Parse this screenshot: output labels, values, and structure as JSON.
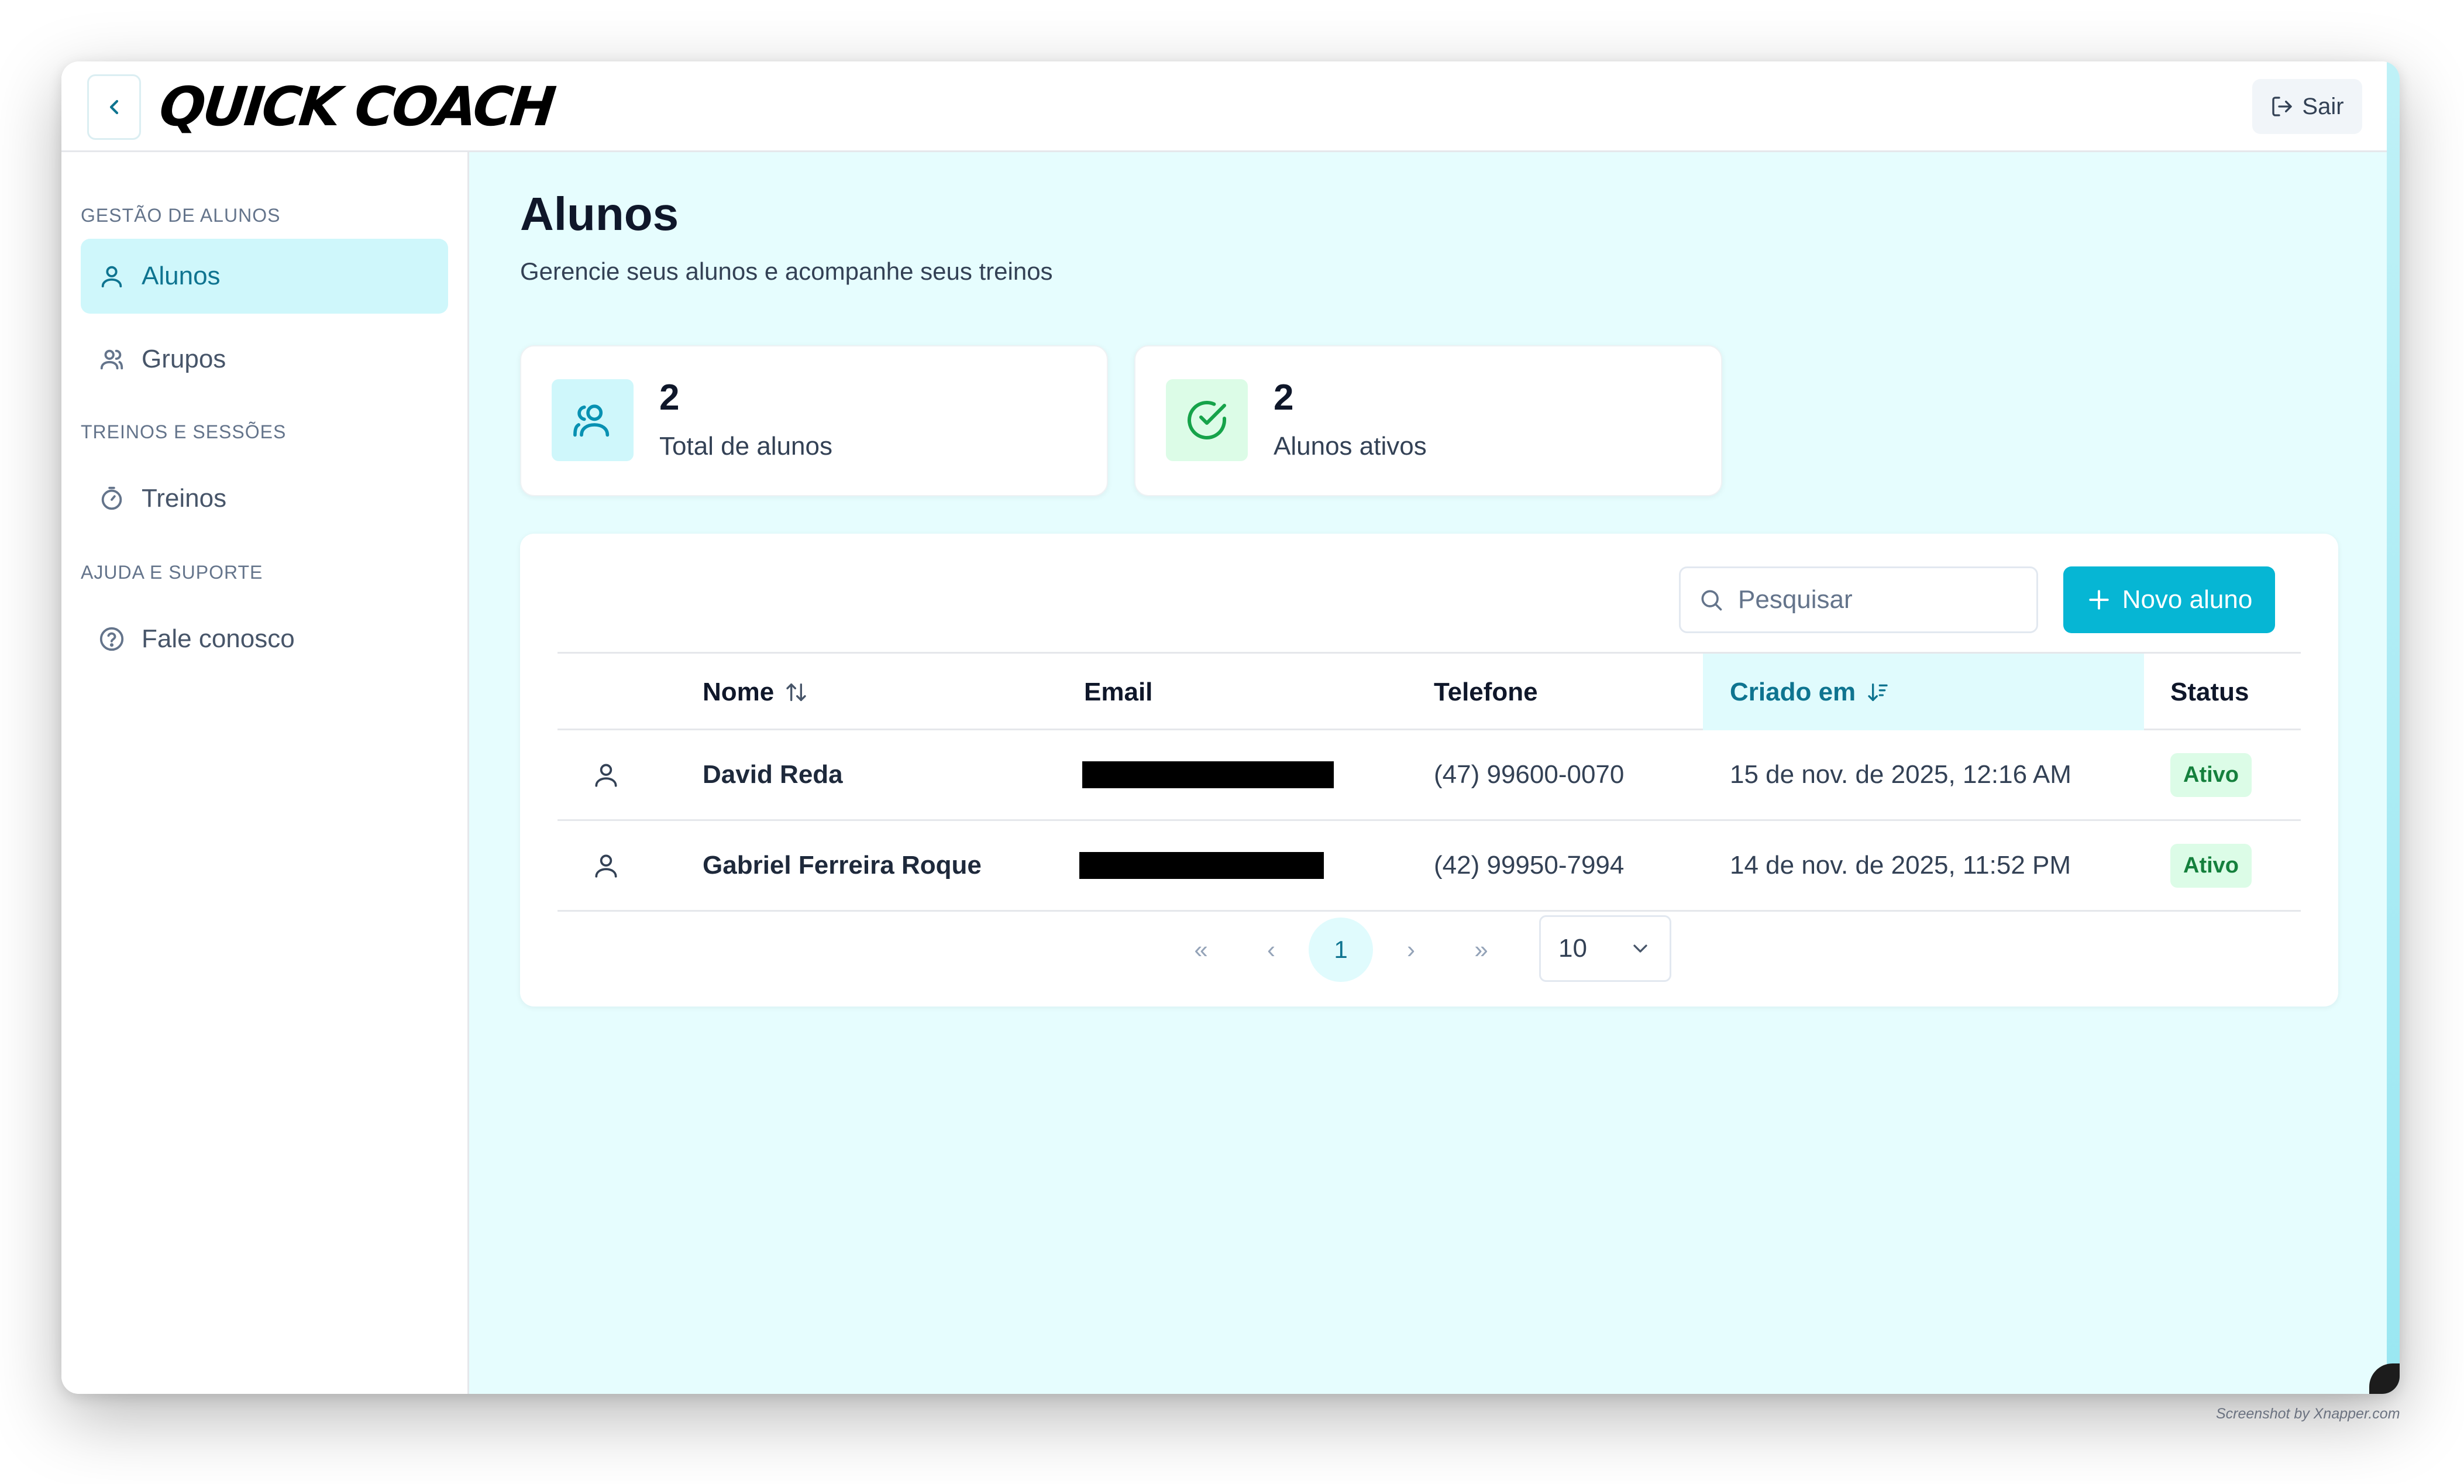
{
  "header": {
    "logo_text": "QUICK COACH",
    "exit_label": "Sair"
  },
  "sidebar": {
    "sections": [
      {
        "title": "GESTÃO DE ALUNOS",
        "items": [
          {
            "label": "Alunos",
            "icon": "user-icon",
            "active": true
          },
          {
            "label": "Grupos",
            "icon": "users-icon",
            "active": false
          }
        ]
      },
      {
        "title": "TREINOS E SESSÕES",
        "items": [
          {
            "label": "Treinos",
            "icon": "timer-icon",
            "active": false
          }
        ]
      },
      {
        "title": "AJUDA E SUPORTE",
        "items": [
          {
            "label": "Fale conosco",
            "icon": "help-circle-icon",
            "active": false
          }
        ]
      }
    ]
  },
  "main": {
    "title": "Alunos",
    "subtitle": "Gerencie seus alunos e acompanhe seus treinos",
    "stats": [
      {
        "value": "2",
        "label": "Total de alunos",
        "icon": "users-icon",
        "color": "#0891b2",
        "bg": "#cff7fb"
      },
      {
        "value": "2",
        "label": "Alunos ativos",
        "icon": "check-circle-icon",
        "color": "#16a34a",
        "bg": "#dcfce7"
      }
    ],
    "search": {
      "placeholder": "Pesquisar"
    },
    "new_button_label": "Novo aluno",
    "table": {
      "columns": {
        "name": "Nome",
        "email": "Email",
        "phone": "Telefone",
        "created": "Criado em",
        "status": "Status"
      },
      "rows": [
        {
          "name": "David Reda",
          "email": "",
          "phone": "(47) 99600-0070",
          "created": "15 de nov. de 2025, 12:16 AM",
          "status": "Ativo"
        },
        {
          "name": "Gabriel Ferreira Roque",
          "email": "",
          "phone": "(42) 99950-7994",
          "created": "14 de nov. de 2025, 11:52 PM",
          "status": "Ativo"
        }
      ]
    },
    "pagination": {
      "first": "«",
      "prev": "‹",
      "current_page": "1",
      "next": "›",
      "last": "»",
      "page_size": "10"
    }
  },
  "colors": {
    "accent": "#06b6d4",
    "accent_dark": "#0e7490",
    "main_bg": "#e6fdfe",
    "active_bg": "#cff7fb",
    "status_green": "#15803d"
  },
  "watermark": "Screenshot by Xnapper.com"
}
